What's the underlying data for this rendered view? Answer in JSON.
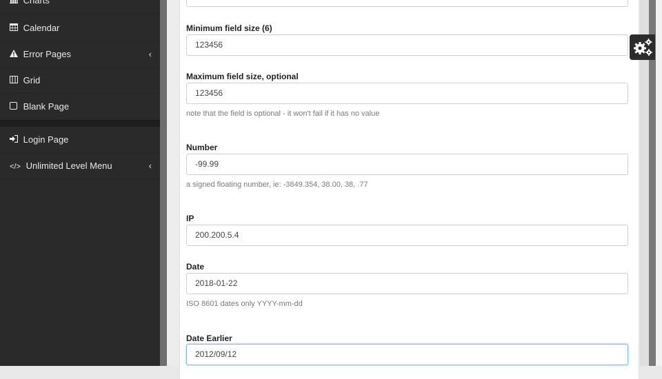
{
  "sidebar": {
    "items": [
      {
        "icon": "bar-chart-icon",
        "glyph": "📊",
        "label": "Charts",
        "chevron": ""
      },
      {
        "icon": "calendar-icon",
        "glyph": "▦",
        "label": "Calendar",
        "chevron": ""
      },
      {
        "icon": "warning-icon",
        "glyph": "▲",
        "label": "Error Pages",
        "chevron": "‹"
      },
      {
        "icon": "grid-icon",
        "glyph": "◫",
        "label": "Grid",
        "chevron": ""
      },
      {
        "icon": "blank-page-icon",
        "glyph": "▢",
        "label": "Blank Page",
        "chevron": ""
      },
      {
        "icon": "login-icon",
        "glyph": "➜",
        "label": "Login Page",
        "chevron": ""
      },
      {
        "icon": "code-icon",
        "glyph": "</>",
        "label": "Unlimited Level Menu",
        "chevron": "‹"
      }
    ]
  },
  "form": {
    "min_size": {
      "label": "Minimum field size (6)",
      "value": "123456"
    },
    "max_size": {
      "label": "Maximum field size, optional",
      "value": "123456",
      "help": "note that the field is optional - it won't fail if it has no value"
    },
    "number": {
      "label": "Number",
      "value": "-99.99",
      "help": "a signed floating number, ie: -3849.354, 38.00, 38, .77"
    },
    "ip": {
      "label": "IP",
      "value": "200.200.5.4"
    },
    "date": {
      "label": "Date",
      "value": "2018-01-22",
      "help": "ISO 8601 dates only YYYY-mm-dd"
    },
    "date_earlier": {
      "label": "Date Earlier",
      "value": "2012/09/12"
    }
  },
  "settings": {
    "icon": "gears-icon"
  }
}
